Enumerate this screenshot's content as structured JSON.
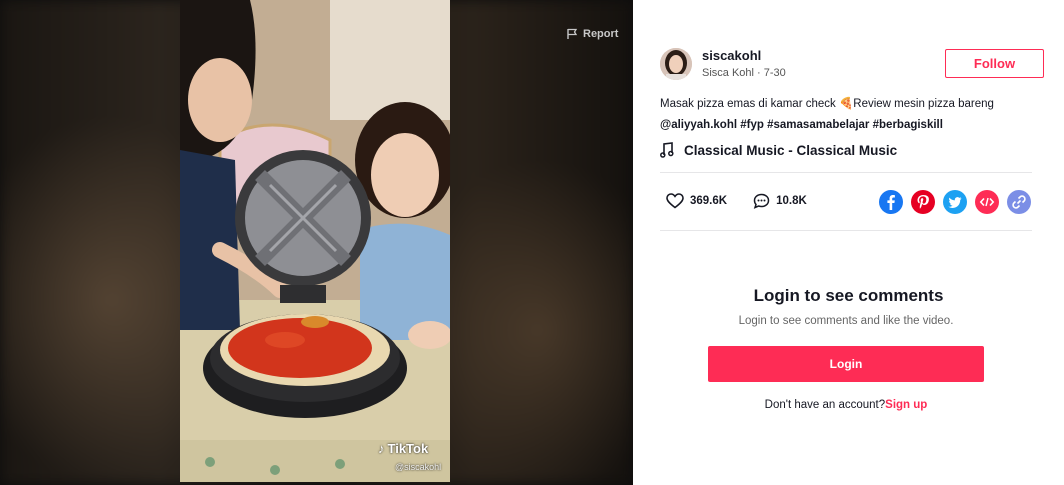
{
  "video": {
    "report_label": "Report",
    "watermark_brand": "TikTok",
    "watermark_handle": "@siscakohl"
  },
  "author": {
    "username": "siscakohl",
    "display_name": "Sisca Kohl",
    "date": "7-30",
    "separator": " · ",
    "follow_label": "Follow"
  },
  "description": {
    "text": "Masak pizza emas di kamar check ",
    "emoji": "🍕",
    "text2": "Review mesin pizza bareng",
    "tags": [
      "@aliyyah.kohl",
      "#fyp",
      "#samasamabelajar",
      "#berbagiskill"
    ]
  },
  "music": {
    "title": "Classical Music - Classical Music"
  },
  "stats": {
    "likes": "369.6K",
    "comments": "10.8K"
  },
  "share_icons": [
    "facebook-icon",
    "pinterest-icon",
    "twitter-icon",
    "embed-icon",
    "copy-link-icon"
  ],
  "colors": {
    "accent": "#fe2c55",
    "facebook": "#1877f2",
    "pinterest": "#e60023",
    "twitter": "#1da1f2",
    "embed": "#fe2c55",
    "link": "#7b8ee6"
  },
  "comments_gate": {
    "title": "Login to see comments",
    "subtitle": "Login to see comments and like the video.",
    "login_label": "Login",
    "no_account_text": "Don't have an account?",
    "signup_label": "Sign up"
  }
}
